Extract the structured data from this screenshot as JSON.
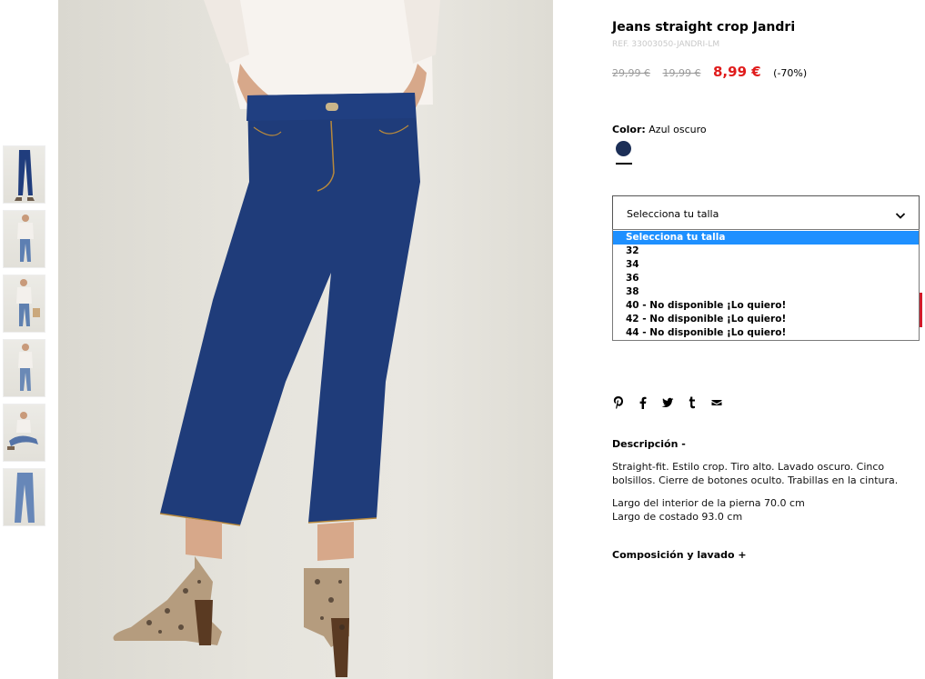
{
  "product": {
    "title": "Jeans straight crop Jandri",
    "ref": "REF. 33003050-JANDRI-LM",
    "price_original": "29,99 €",
    "price_previous": "19,99 €",
    "price_sale": "8,99 €",
    "discount": "(-70%)"
  },
  "color": {
    "label": "Color:",
    "value": "Azul oscuro",
    "swatch_hex": "#1c2f57"
  },
  "size_select": {
    "placeholder": "Selecciona tu talla",
    "options": [
      "Selecciona tu talla",
      "32",
      "34",
      "36",
      "38",
      "40 - No disponible ¡Lo quiero!",
      "42 - No disponible ¡Lo quiero!",
      "44 - No disponible ¡Lo quiero!"
    ],
    "highlighted_index": 0
  },
  "share": {
    "icons": [
      "pinterest-icon",
      "facebook-icon",
      "twitter-icon",
      "tumblr-icon",
      "email-icon"
    ]
  },
  "description": {
    "title": "Descripción  -",
    "text": "Straight-fit. Estilo crop. Tiro alto. Lavado oscuro. Cinco bolsillos. Cierre de botones oculto. Trabillas en la cintura.",
    "inseam": "Largo del interior de la pierna 70.0 cm",
    "side_length": "Largo de costado 93.0 cm"
  },
  "composition": {
    "title": "Composición y lavado  +"
  },
  "gallery": {
    "thumbnail_count": 6
  },
  "colors": {
    "sale_red": "#e01b1b",
    "highlight_blue": "#1e90ff",
    "denim": "#1f3c7a"
  }
}
